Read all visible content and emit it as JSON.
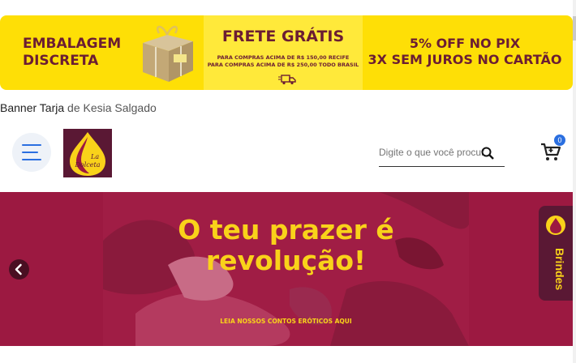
{
  "promo": {
    "left_line1": "EMBALAGEM",
    "left_line2": "DISCRETA",
    "frete_title": "FRETE GRÁTIS",
    "frete_line1": "PARA COMPRAS ACIMA DE R$ 150,00 RECIFE",
    "frete_line2": "PARA COMPRAS ACIMA DE R$ 250,00 TODO BRASIL",
    "right_line1": "5% OFF NO PIX",
    "right_line2": "3X SEM JUROS NO CARTÃO"
  },
  "credit": {
    "title": "Banner Tarja",
    "by": "de Kesia Salgado"
  },
  "header": {
    "logo_line1": "La",
    "logo_line2": "Dolceta",
    "search_placeholder": "Digite o que você procura",
    "cart_count": "0"
  },
  "hero": {
    "title_line1": "O teu prazer é",
    "title_line2": "revolução!",
    "subtitle": "LEIA NOSSOS CONTOS ERÓTICOS AQUI"
  },
  "brindes": {
    "label": "Brindes"
  },
  "colors": {
    "promo_yellow": "#fedf06",
    "brand_wine": "#9c1941",
    "brand_dark": "#5a1834",
    "accent_blue": "#2b6fe0",
    "hero_text": "#f9d21a"
  }
}
